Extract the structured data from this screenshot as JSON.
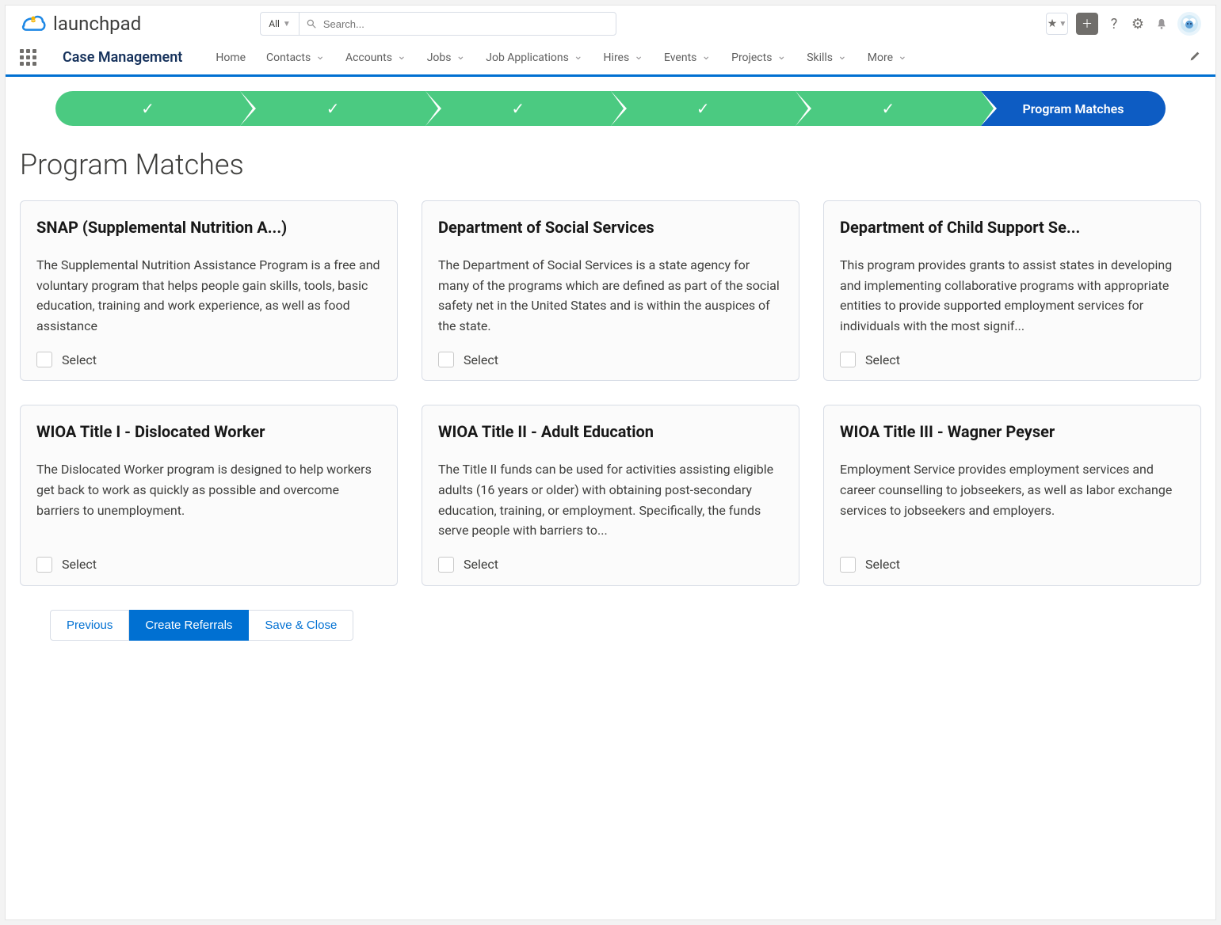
{
  "header": {
    "brand": "launchpad",
    "search_scope": "All",
    "search_placeholder": "Search..."
  },
  "nav": {
    "appname": "Case Management",
    "items": [
      {
        "label": "Home",
        "chev": false
      },
      {
        "label": "Contacts",
        "chev": true
      },
      {
        "label": "Accounts",
        "chev": true
      },
      {
        "label": "Jobs",
        "chev": true
      },
      {
        "label": "Job Applications",
        "chev": true
      },
      {
        "label": "Hires",
        "chev": true
      },
      {
        "label": "Events",
        "chev": true
      },
      {
        "label": "Projects",
        "chev": true
      },
      {
        "label": "Skills",
        "chev": true
      },
      {
        "label": "More",
        "chev": true
      }
    ]
  },
  "stepper": {
    "active_label": "Program Matches"
  },
  "page": {
    "title": "Program Matches"
  },
  "cards": [
    {
      "title": "SNAP (Supplemental Nutrition A...)",
      "desc": "The Supplemental Nutrition Assistance Program is a free and voluntary program that helps people gain skills, tools, basic education, training and work experience, as well as food assistance",
      "select": "Select"
    },
    {
      "title": "Department of Social Services",
      "desc": "The Department of Social Services is a state agency for many of the programs which are defined as part of the social safety net in the United States and is within the auspices of the state.",
      "select": "Select"
    },
    {
      "title": "Department of Child Support Se...",
      "desc": "This program provides grants to assist states in developing and implementing collaborative programs with appropriate entities to provide supported employment services for individuals with the most signif...",
      "select": "Select"
    },
    {
      "title": "WIOA Title I - Dislocated Worker",
      "desc": "The Dislocated Worker program is designed to help workers get back to work as quickly as possible and overcome barriers to unemployment.",
      "select": "Select"
    },
    {
      "title": "WIOA Title II - Adult Education",
      "desc": "The Title II funds can be used for activities assisting eligible adults (16 years or older) with obtaining post-secondary education, training, or employment. Specifically, the funds serve people with barriers to...",
      "select": "Select"
    },
    {
      "title": "WIOA Title III - Wagner Peyser",
      "desc": "Employment Service provides employment services and career counselling to jobseekers, as well as labor exchange services to jobseekers and employers.",
      "select": "Select"
    }
  ],
  "footer": {
    "previous": "Previous",
    "create": "Create Referrals",
    "save": "Save & Close"
  }
}
